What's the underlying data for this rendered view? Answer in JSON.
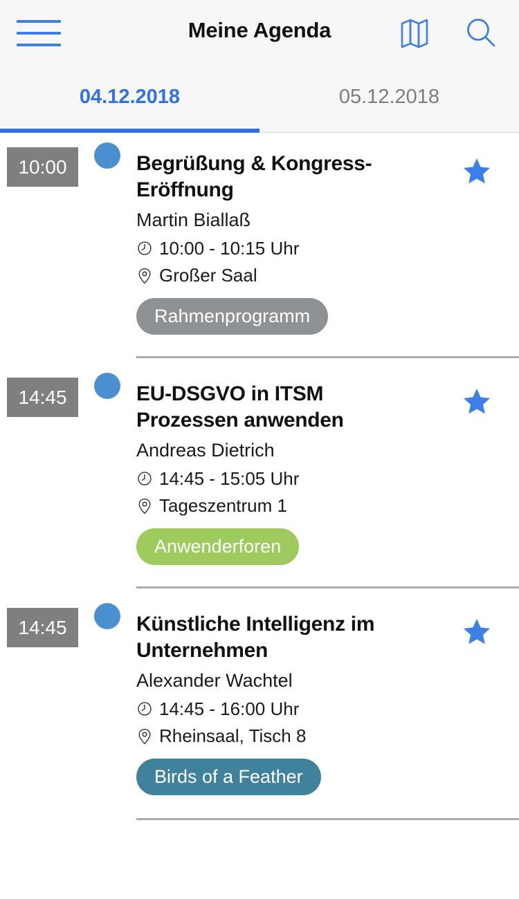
{
  "topbar": {
    "title": "Meine Agenda",
    "menu_icon": "hamburger-menu-icon",
    "map_icon": "map-icon",
    "search_icon": "search-icon"
  },
  "tabs": {
    "items": [
      {
        "label": "04.12.2018",
        "active": true
      },
      {
        "label": "05.12.2018",
        "active": false
      }
    ],
    "active_color": "#2f72e8",
    "inactive_color": "#7d7d7d"
  },
  "timeline": {
    "line_color": "#5b9bd5",
    "dot_color": "#4a90d0",
    "badge_bg": "#7f7f7f"
  },
  "events": [
    {
      "time_badge": "10:00",
      "title": "Begrüßung & Kongress-Eröffnung",
      "speaker": "Martin Biallaß",
      "time_icon": "clock-icon",
      "time_range": "10:00 - 10:15 Uhr",
      "location_icon": "location-pin-icon",
      "location": "Großer Saal",
      "tag": "Rahmenprogramm",
      "tag_color": "#8e9294",
      "starred": true,
      "star_icon": "star-icon"
    },
    {
      "time_badge": "14:45",
      "title": "EU-DSGVO in ITSM Prozessen anwenden",
      "speaker": "Andreas Dietrich",
      "time_icon": "clock-icon",
      "time_range": "14:45 - 15:05 Uhr",
      "location_icon": "location-pin-icon",
      "location": "Tageszentrum 1",
      "tag": "Anwenderforen",
      "tag_color": "#9ecb5e",
      "starred": true,
      "star_icon": "star-icon"
    },
    {
      "time_badge": "14:45",
      "title": "Künstliche Intelligenz im Unternehmen",
      "speaker": "Alexander Wachtel",
      "time_icon": "clock-icon",
      "time_range": "14:45 - 16:00 Uhr",
      "location_icon": "location-pin-icon",
      "location": "Rheinsaal, Tisch 8",
      "tag": "Birds of a Feather",
      "tag_color": "#40819b",
      "starred": true,
      "star_icon": "star-icon"
    }
  ]
}
